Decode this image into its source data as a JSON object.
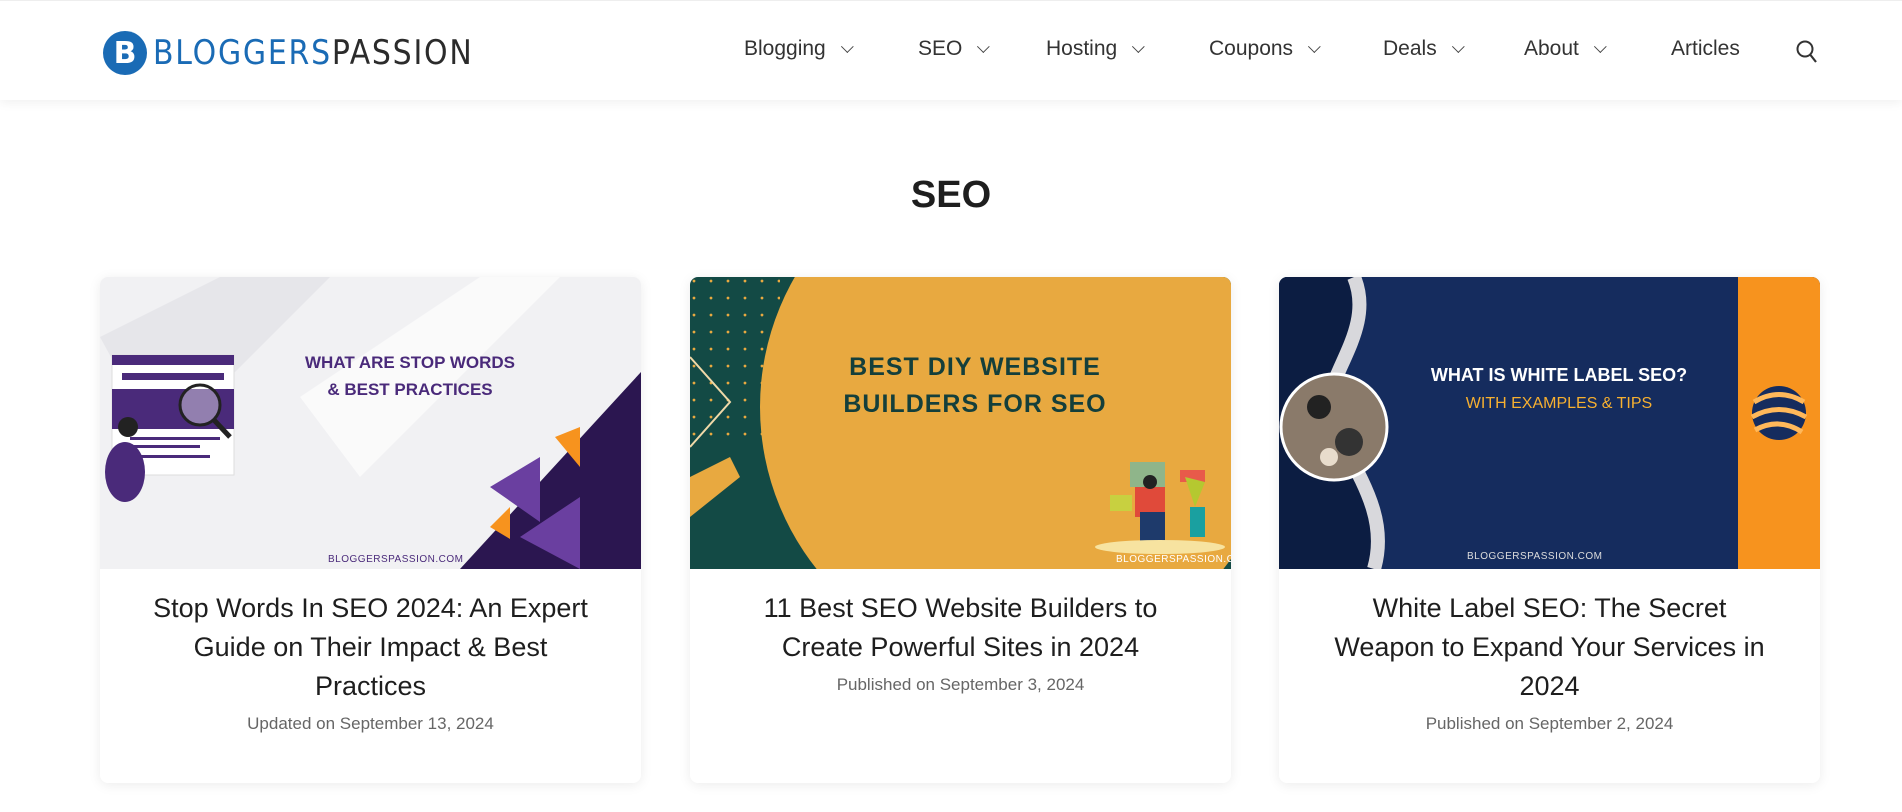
{
  "header": {
    "logo": {
      "part1": "BLOGGERS",
      "part2": "PASSION",
      "badge": "B"
    },
    "nav": [
      {
        "label": "Blogging",
        "dropdown": true
      },
      {
        "label": "SEO",
        "dropdown": true
      },
      {
        "label": "Hosting",
        "dropdown": true
      },
      {
        "label": "Coupons",
        "dropdown": true
      },
      {
        "label": "Deals",
        "dropdown": true
      },
      {
        "label": "About",
        "dropdown": true
      },
      {
        "label": "Articles",
        "dropdown": false
      }
    ],
    "search_icon": "search-icon"
  },
  "page": {
    "title": "SEO"
  },
  "colors": {
    "brand": "#1a6bb5",
    "purple": "#4a2a7a",
    "orange": "#f7931e",
    "teal": "#134a45",
    "mustard": "#e8a940",
    "navy": "#152c5e"
  },
  "posts": [
    {
      "image_text": [
        "WHAT ARE STOP WORDS",
        "& BEST PRACTICES"
      ],
      "image_url": "BLOGGERSPASSION.COM",
      "title": "Stop Words In SEO 2024: An Expert Guide on Their Impact & Best Practices",
      "date": "Updated on September 13, 2024"
    },
    {
      "image_text": [
        "BEST DIY WEBSITE",
        "BUILDERS FOR SEO"
      ],
      "image_url": "BLOGGERSPASSION.COM",
      "title": "11 Best SEO Website Builders to Create Powerful Sites in 2024",
      "date": "Published on September 3, 2024"
    },
    {
      "image_text": [
        "WHAT IS WHITE LABEL SEO?",
        "WITH EXAMPLES & TIPS"
      ],
      "image_url": "BLOGGERSPASSION.COM",
      "title": "White Label SEO: The Secret Weapon to Expand Your Services in 2024",
      "date": "Published on September 2, 2024"
    }
  ]
}
